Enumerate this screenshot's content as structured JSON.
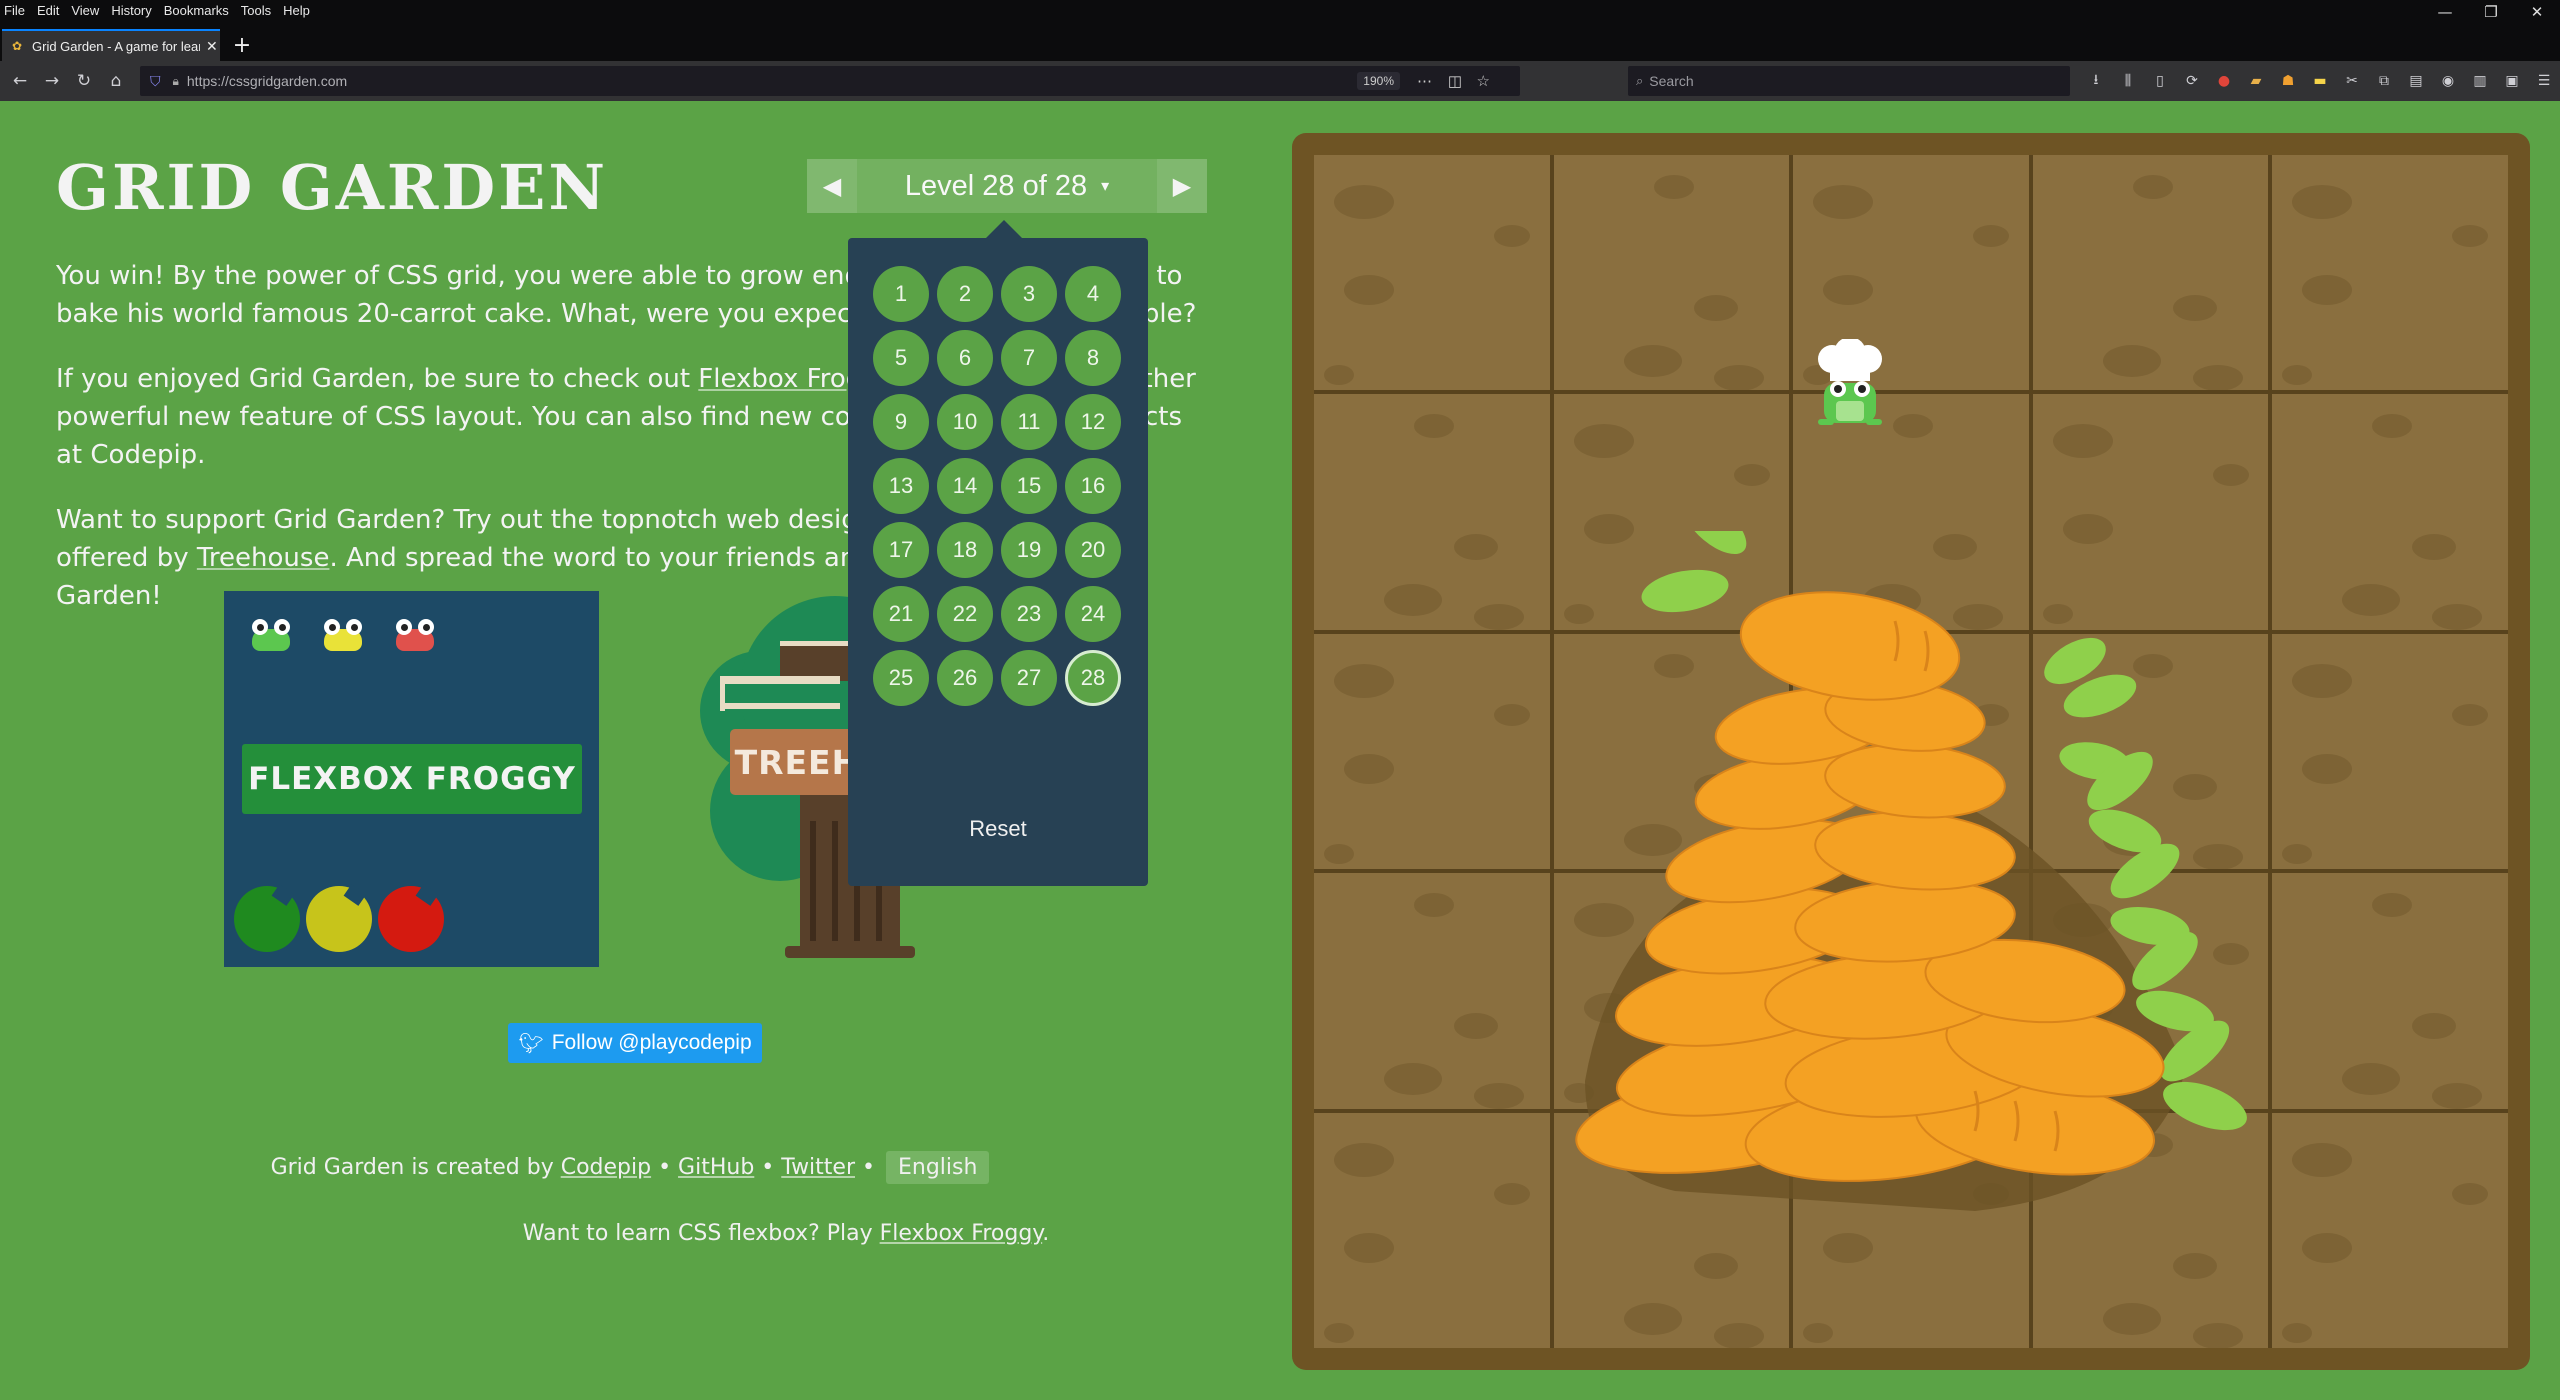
{
  "menubar": [
    "File",
    "Edit",
    "View",
    "History",
    "Bookmarks",
    "Tools",
    "Help"
  ],
  "window_controls": [
    "—",
    "❐",
    "✕"
  ],
  "tab": {
    "title": "Grid Garden - A game for learn",
    "close": "✕",
    "new_tab": "+"
  },
  "navbar": {
    "url": "https://cssgridgarden.com",
    "zoom": "190%",
    "search_placeholder": "Search"
  },
  "page": {
    "title": "GRID GARDEN",
    "level_label": "Level 28 of 28",
    "level_caret": "▾",
    "prev_arrow": "◀",
    "next_arrow": "▶",
    "intro": {
      "p1": "You win! By the power of CSS grid, you were able to grow enough carrots for Froggy to bake his world famous 20-carrot cake. What, were you expecting a different vegetable?",
      "p2_before": "If you enjoyed Grid Garden, be sure to check out ",
      "p2_link": "Flexbox Froggy",
      "p2_after": " to learn about another powerful new feature of CSS layout. You can also find new coding games and products at Codepip.",
      "p3_before": "Want to support Grid Garden? Try out the topnotch web design and coding courses offered by ",
      "p3_link": "Treehouse",
      "p3_after": ". And spread the word to your friends and family about Grid Garden!"
    },
    "froggy_logo": "FLEXBOX FROGGY",
    "treehouse_logo": "TREEHOUSE",
    "follow_button": "Follow @playcodepip",
    "credits": {
      "prefix": "Grid Garden is created by ",
      "codepip": "Codepip",
      "sep": " • ",
      "github": "GitHub",
      "twitter": "Twitter",
      "language": "English"
    },
    "promo": {
      "prefix": "Want to learn CSS flexbox? Play ",
      "link": "Flexbox Froggy",
      "suffix": "."
    }
  },
  "level_menu": {
    "levels": [
      "1",
      "2",
      "3",
      "4",
      "5",
      "6",
      "7",
      "8",
      "9",
      "10",
      "11",
      "12",
      "13",
      "14",
      "15",
      "16",
      "17",
      "18",
      "19",
      "20",
      "21",
      "22",
      "23",
      "24",
      "25",
      "26",
      "27",
      "28"
    ],
    "current": "28",
    "reset": "Reset"
  },
  "colors": {
    "page_bg": "#5ba346",
    "dropdown_bg": "#274154",
    "garden_border": "#6e5424",
    "soil": "#8a6f3f",
    "carrot": "#f4a123",
    "froggy_card": "#1d4a66",
    "twitter_blue": "#1d9bf0"
  }
}
